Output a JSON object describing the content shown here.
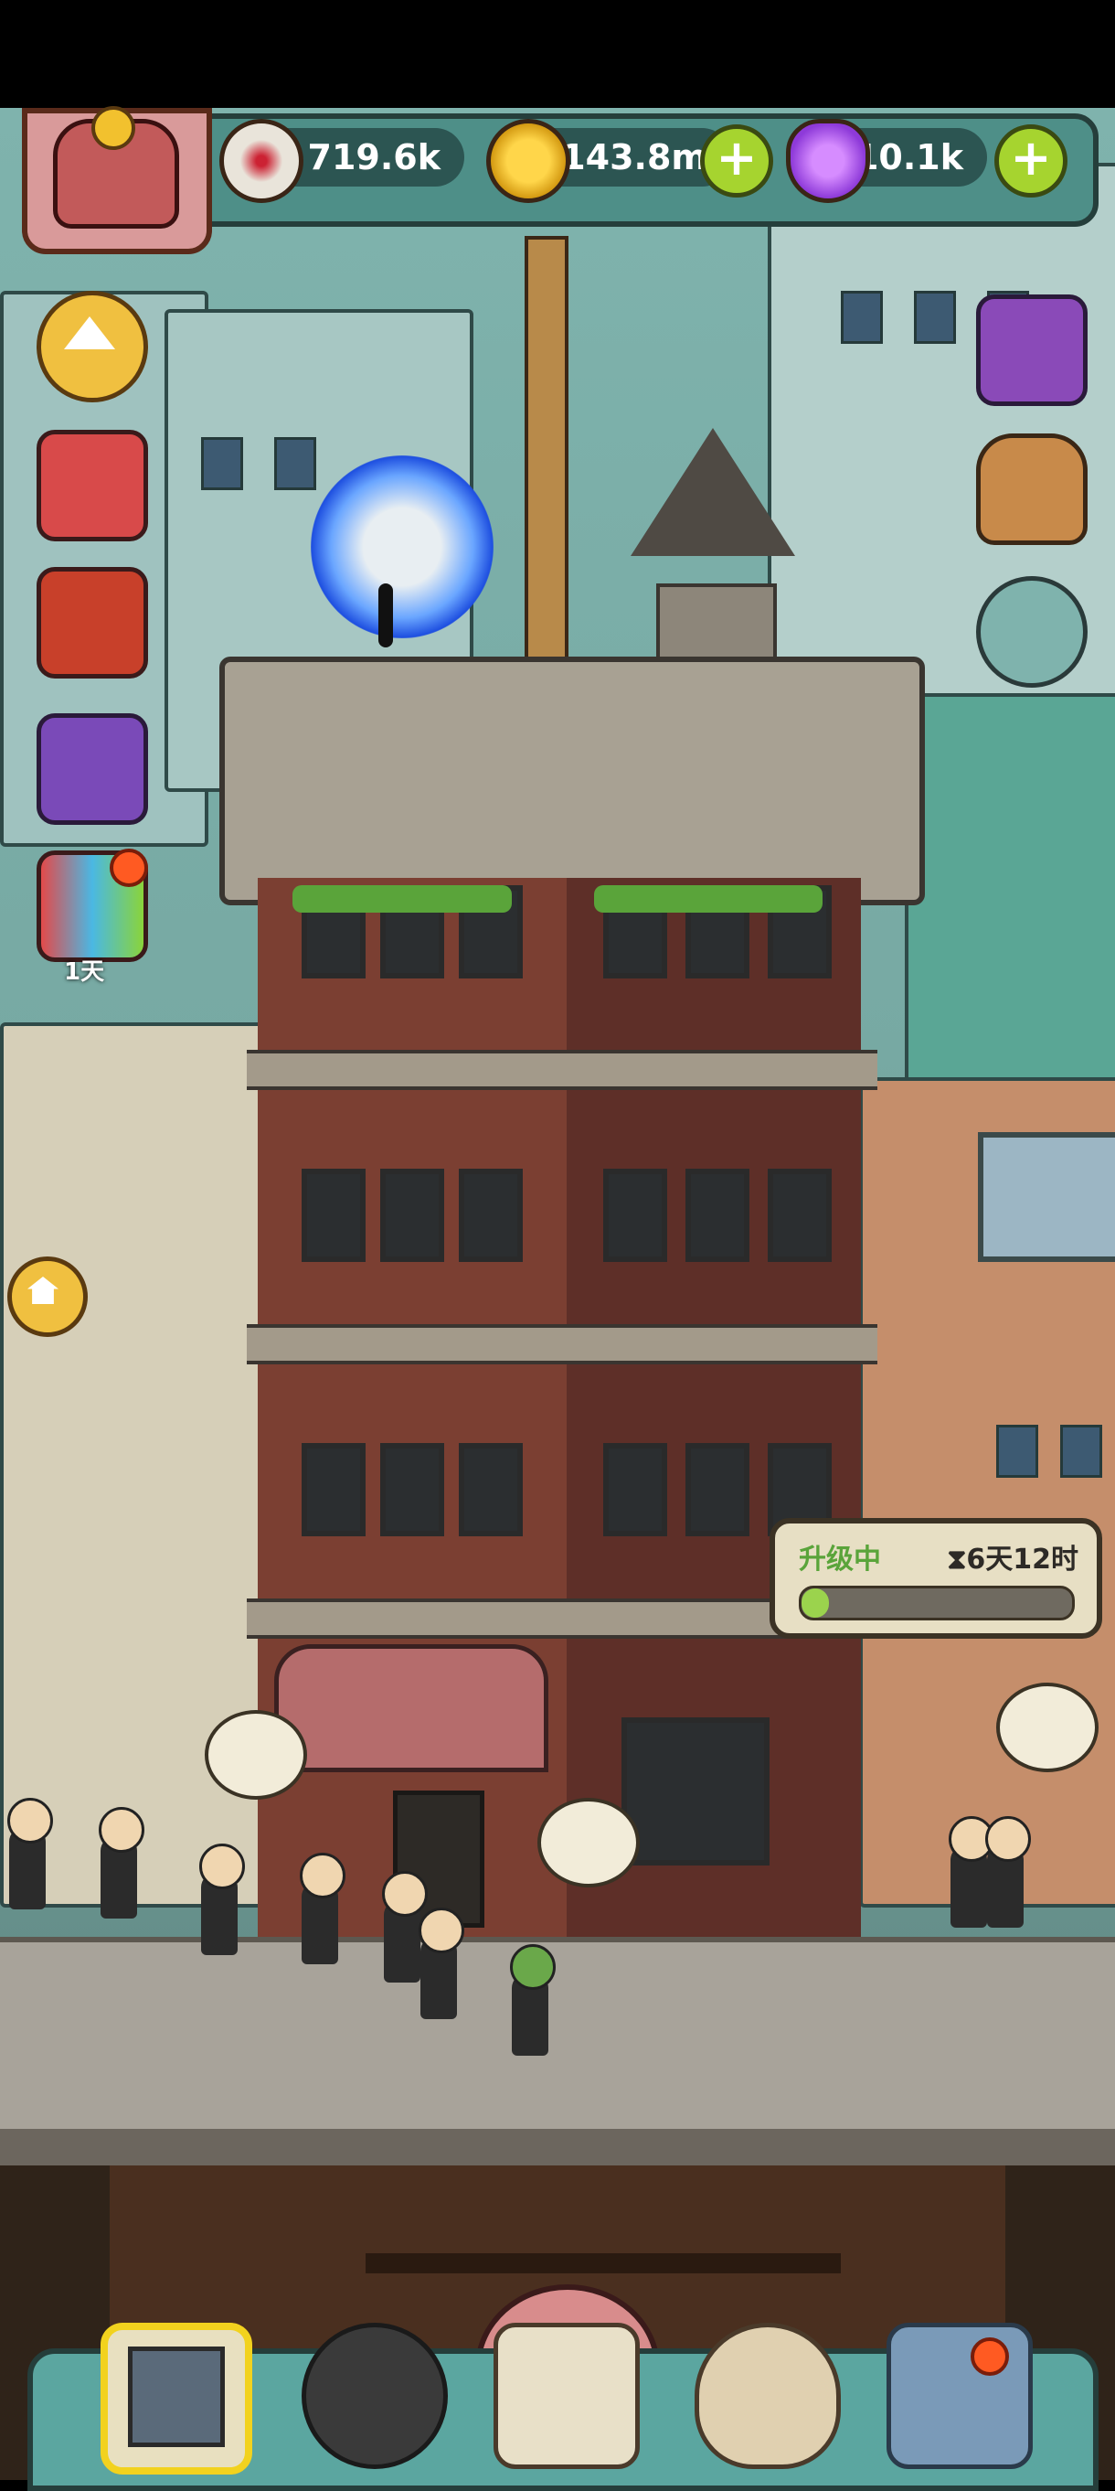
{
  "resources": {
    "eyes": {
      "value": "719.6k",
      "icon": "eyeball-icon"
    },
    "coins": {
      "value": "143.8m",
      "icon": "gold-coin-icon"
    },
    "potion": {
      "value": "10.1k",
      "icon": "purple-potion-icon"
    }
  },
  "sidebar": {
    "event_timer": "1天"
  },
  "upgrade": {
    "label": "升级中",
    "time": "6天12时",
    "progress": 0.1
  },
  "colors": {
    "accent_green": "#a6d42f",
    "badge_red": "#ff5a22",
    "bar_teal": "#4e8f88"
  }
}
